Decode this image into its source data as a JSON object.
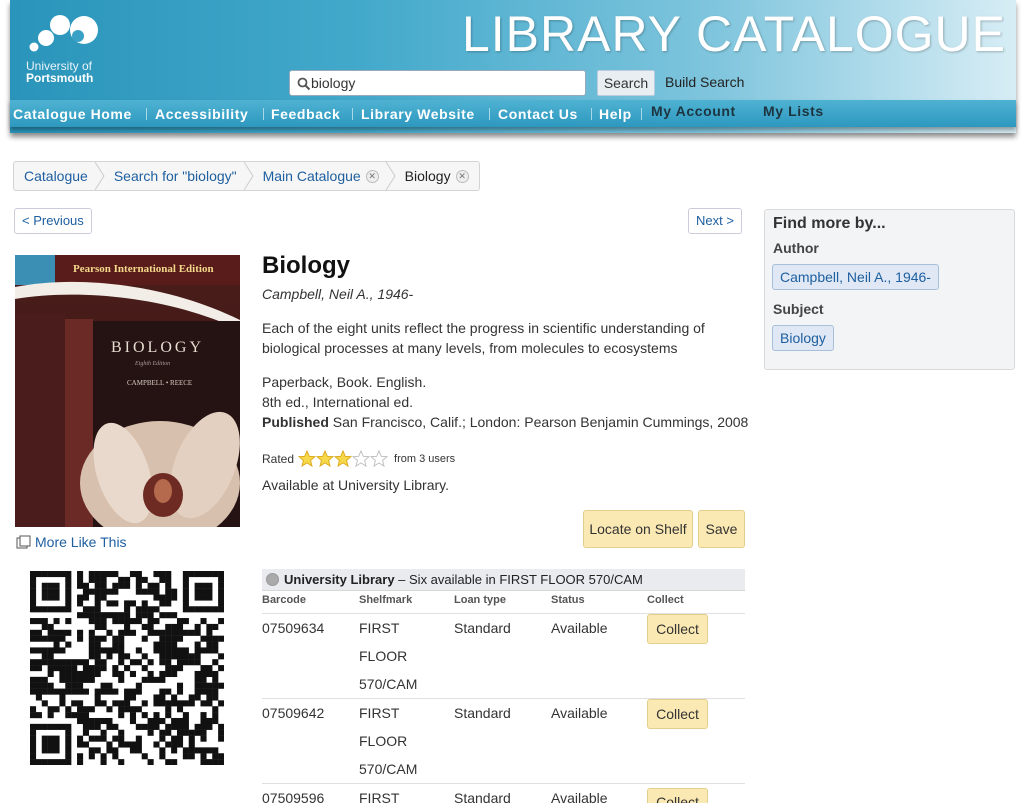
{
  "header": {
    "logo": {
      "line1": "University of",
      "line2": "Portsmouth"
    },
    "title": "LIBRARY CATALOGUE",
    "search": {
      "value": "biology",
      "placeholder": ""
    },
    "search_button": "Search",
    "build_search": "Build Search",
    "nav": [
      "Catalogue Home",
      "Accessibility",
      "Feedback",
      "Library Website",
      "Contact Us",
      "Help",
      "My Account",
      "My Lists"
    ]
  },
  "breadcrumb": [
    "Catalogue",
    "Search for \"biology\"",
    "Main Catalogue",
    "Biology"
  ],
  "pager": {
    "prev": "< Previous",
    "next": "Next >"
  },
  "cover": {
    "edition_banner": "Pearson International Edition",
    "book_title": "BIOLOGY",
    "edition": "Eighth Edition",
    "authors": "CAMPBELL • REECE"
  },
  "more_like_this": "More Like This",
  "record": {
    "title": "Biology",
    "author": "Campbell, Neil A., 1946-",
    "summary": "Each of the eight units reflect the progress in scientific understanding of biological processes at many levels, from molecules to ecosystems",
    "format": "Paperback, Book. English.",
    "edition": "8th ed., International ed.",
    "published_label": "Published",
    "published": "San Francisco, Calif.; London: Pearson Benjamin Cummings, 2008",
    "rated_label": "Rated",
    "rating": 3,
    "rating_max": 5,
    "rating_from": "from 3 users",
    "availability": "Available at University Library.",
    "locate_button": "Locate on Shelf",
    "save_button": "Save"
  },
  "holdings": {
    "library": "University Library",
    "summary": "– Six available in FIRST FLOOR 570/CAM",
    "columns": [
      "Barcode",
      "Shelfmark",
      "Loan type",
      "Status",
      "Collect"
    ],
    "rows": [
      {
        "barcode": "07509634",
        "shelfmark": [
          "FIRST",
          "FLOOR",
          "570/CAM"
        ],
        "loan": "Standard",
        "status": "Available",
        "collect": "Collect"
      },
      {
        "barcode": "07509642",
        "shelfmark": [
          "FIRST",
          "FLOOR",
          "570/CAM"
        ],
        "loan": "Standard",
        "status": "Available",
        "collect": "Collect"
      },
      {
        "barcode": "07509596",
        "shelfmark": [
          "FIRST"
        ],
        "loan": "Standard",
        "status": "Available",
        "collect": "Collect"
      }
    ]
  },
  "find_more": {
    "title": "Find more by...",
    "author_label": "Author",
    "author": "Campbell, Neil A., 1946-",
    "subject_label": "Subject",
    "subject": "Biology"
  }
}
